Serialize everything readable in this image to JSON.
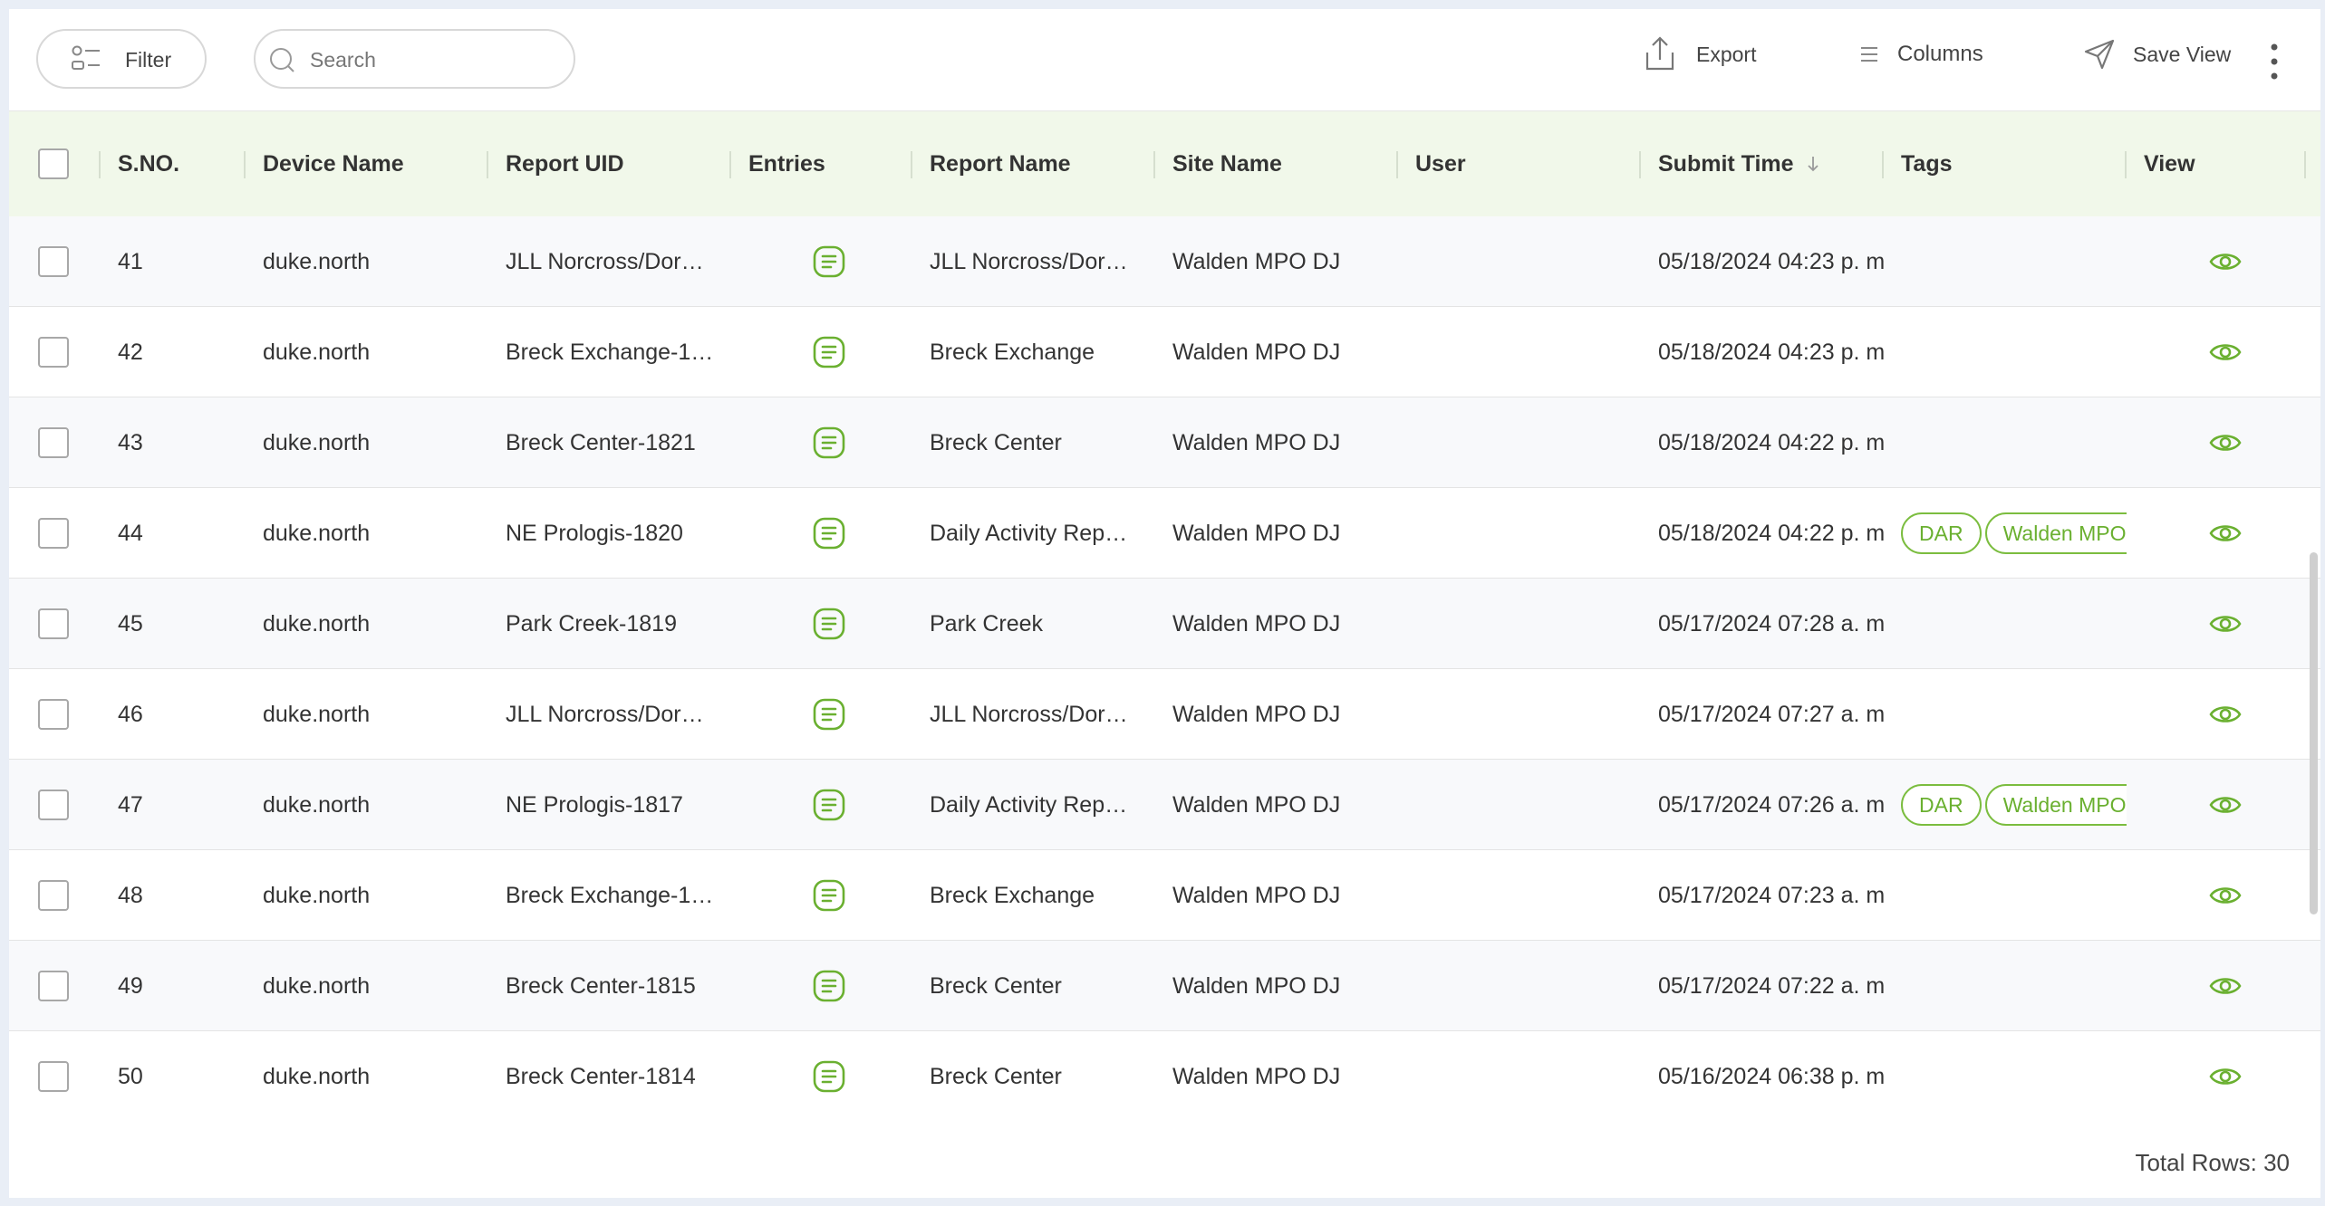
{
  "toolbar": {
    "filter_label": "Filter",
    "search_placeholder": "Search",
    "export_label": "Export",
    "columns_label": "Columns",
    "save_view_label": "Save View"
  },
  "table": {
    "headers": {
      "sno": "S.NO.",
      "device": "Device Name",
      "uid": "Report UID",
      "entries": "Entries",
      "report_name": "Report Name",
      "site": "Site Name",
      "user": "User",
      "submit": "Submit Time",
      "tags": "Tags",
      "view": "View"
    },
    "sort_column": "Submit Time",
    "sort_direction": "descending",
    "rows": [
      {
        "sno": "41",
        "device": "duke.north",
        "uid": "JLL Norcross/Dor…",
        "report_name": "JLL Norcross/Dor…",
        "site": "Walden MPO DJ",
        "user": "",
        "submit": "05/18/2024 04:23 p. m",
        "tags": []
      },
      {
        "sno": "42",
        "device": "duke.north",
        "uid": "Breck Exchange-1…",
        "report_name": "Breck Exchange",
        "site": "Walden MPO DJ",
        "user": "",
        "submit": "05/18/2024 04:23 p. m",
        "tags": []
      },
      {
        "sno": "43",
        "device": "duke.north",
        "uid": "Breck Center-1821",
        "report_name": "Breck Center",
        "site": "Walden MPO DJ",
        "user": "",
        "submit": "05/18/2024 04:22 p. m",
        "tags": []
      },
      {
        "sno": "44",
        "device": "duke.north",
        "uid": "NE Prologis-1820",
        "report_name": "Daily Activity Rep…",
        "site": "Walden MPO DJ",
        "user": "",
        "submit": "05/18/2024 04:22 p. m",
        "tags": [
          "DAR",
          "Walden MPO DJ"
        ]
      },
      {
        "sno": "45",
        "device": "duke.north",
        "uid": "Park Creek-1819",
        "report_name": "Park Creek",
        "site": "Walden MPO DJ",
        "user": "",
        "submit": "05/17/2024 07:28 a. m",
        "tags": []
      },
      {
        "sno": "46",
        "device": "duke.north",
        "uid": "JLL Norcross/Dor…",
        "report_name": "JLL Norcross/Dor…",
        "site": "Walden MPO DJ",
        "user": "",
        "submit": "05/17/2024 07:27 a. m",
        "tags": []
      },
      {
        "sno": "47",
        "device": "duke.north",
        "uid": "NE Prologis-1817",
        "report_name": "Daily Activity Rep…",
        "site": "Walden MPO DJ",
        "user": "",
        "submit": "05/17/2024 07:26 a. m",
        "tags": [
          "DAR",
          "Walden MPO DJ"
        ]
      },
      {
        "sno": "48",
        "device": "duke.north",
        "uid": "Breck Exchange-1…",
        "report_name": "Breck Exchange",
        "site": "Walden MPO DJ",
        "user": "",
        "submit": "05/17/2024 07:23 a. m",
        "tags": []
      },
      {
        "sno": "49",
        "device": "duke.north",
        "uid": "Breck Center-1815",
        "report_name": "Breck Center",
        "site": "Walden MPO DJ",
        "user": "",
        "submit": "05/17/2024 07:22 a. m",
        "tags": []
      },
      {
        "sno": "50",
        "device": "duke.north",
        "uid": "Breck Center-1814",
        "report_name": "Breck Center",
        "site": "Walden MPO DJ",
        "user": "",
        "submit": "05/16/2024 06:38 p. m",
        "tags": []
      }
    ]
  },
  "footer": {
    "total_rows": "Total Rows: 30"
  },
  "icons": {
    "entries": "document-lines-icon",
    "view": "eye-icon",
    "sort": "arrow-down-icon"
  },
  "colors": {
    "accent": "#6ab030",
    "header_bg": "#f1f8ea"
  }
}
